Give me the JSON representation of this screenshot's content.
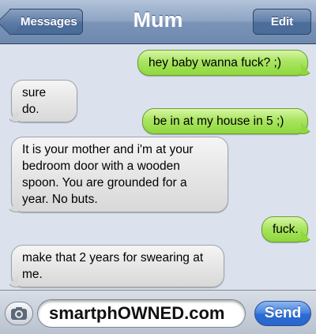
{
  "navbar": {
    "back_label": "Messages",
    "title": "Mum",
    "edit_label": "Edit"
  },
  "messages": [
    {
      "direction": "out",
      "text": "hey baby wanna fuck? ;)"
    },
    {
      "direction": "in",
      "text": "sure do."
    },
    {
      "direction": "out",
      "text": "be in at my house in 5 ;)"
    },
    {
      "direction": "in",
      "text": "It is your mother and i'm at your bedroom door with a wooden spoon. You are grounded for a year. No buts."
    },
    {
      "direction": "out",
      "text": "fuck."
    },
    {
      "direction": "in",
      "text": "make that 2 years for swearing at me."
    }
  ],
  "composer": {
    "camera_icon": "camera-icon",
    "text": "smartphOWNED.com",
    "send_label": "Send"
  },
  "colors": {
    "navbar": "#7a94b8",
    "background": "#dbe2ed",
    "outgoing_bubble": "#a9e561",
    "incoming_bubble": "#e6e6e6",
    "send_button": "#3f7fe0"
  }
}
